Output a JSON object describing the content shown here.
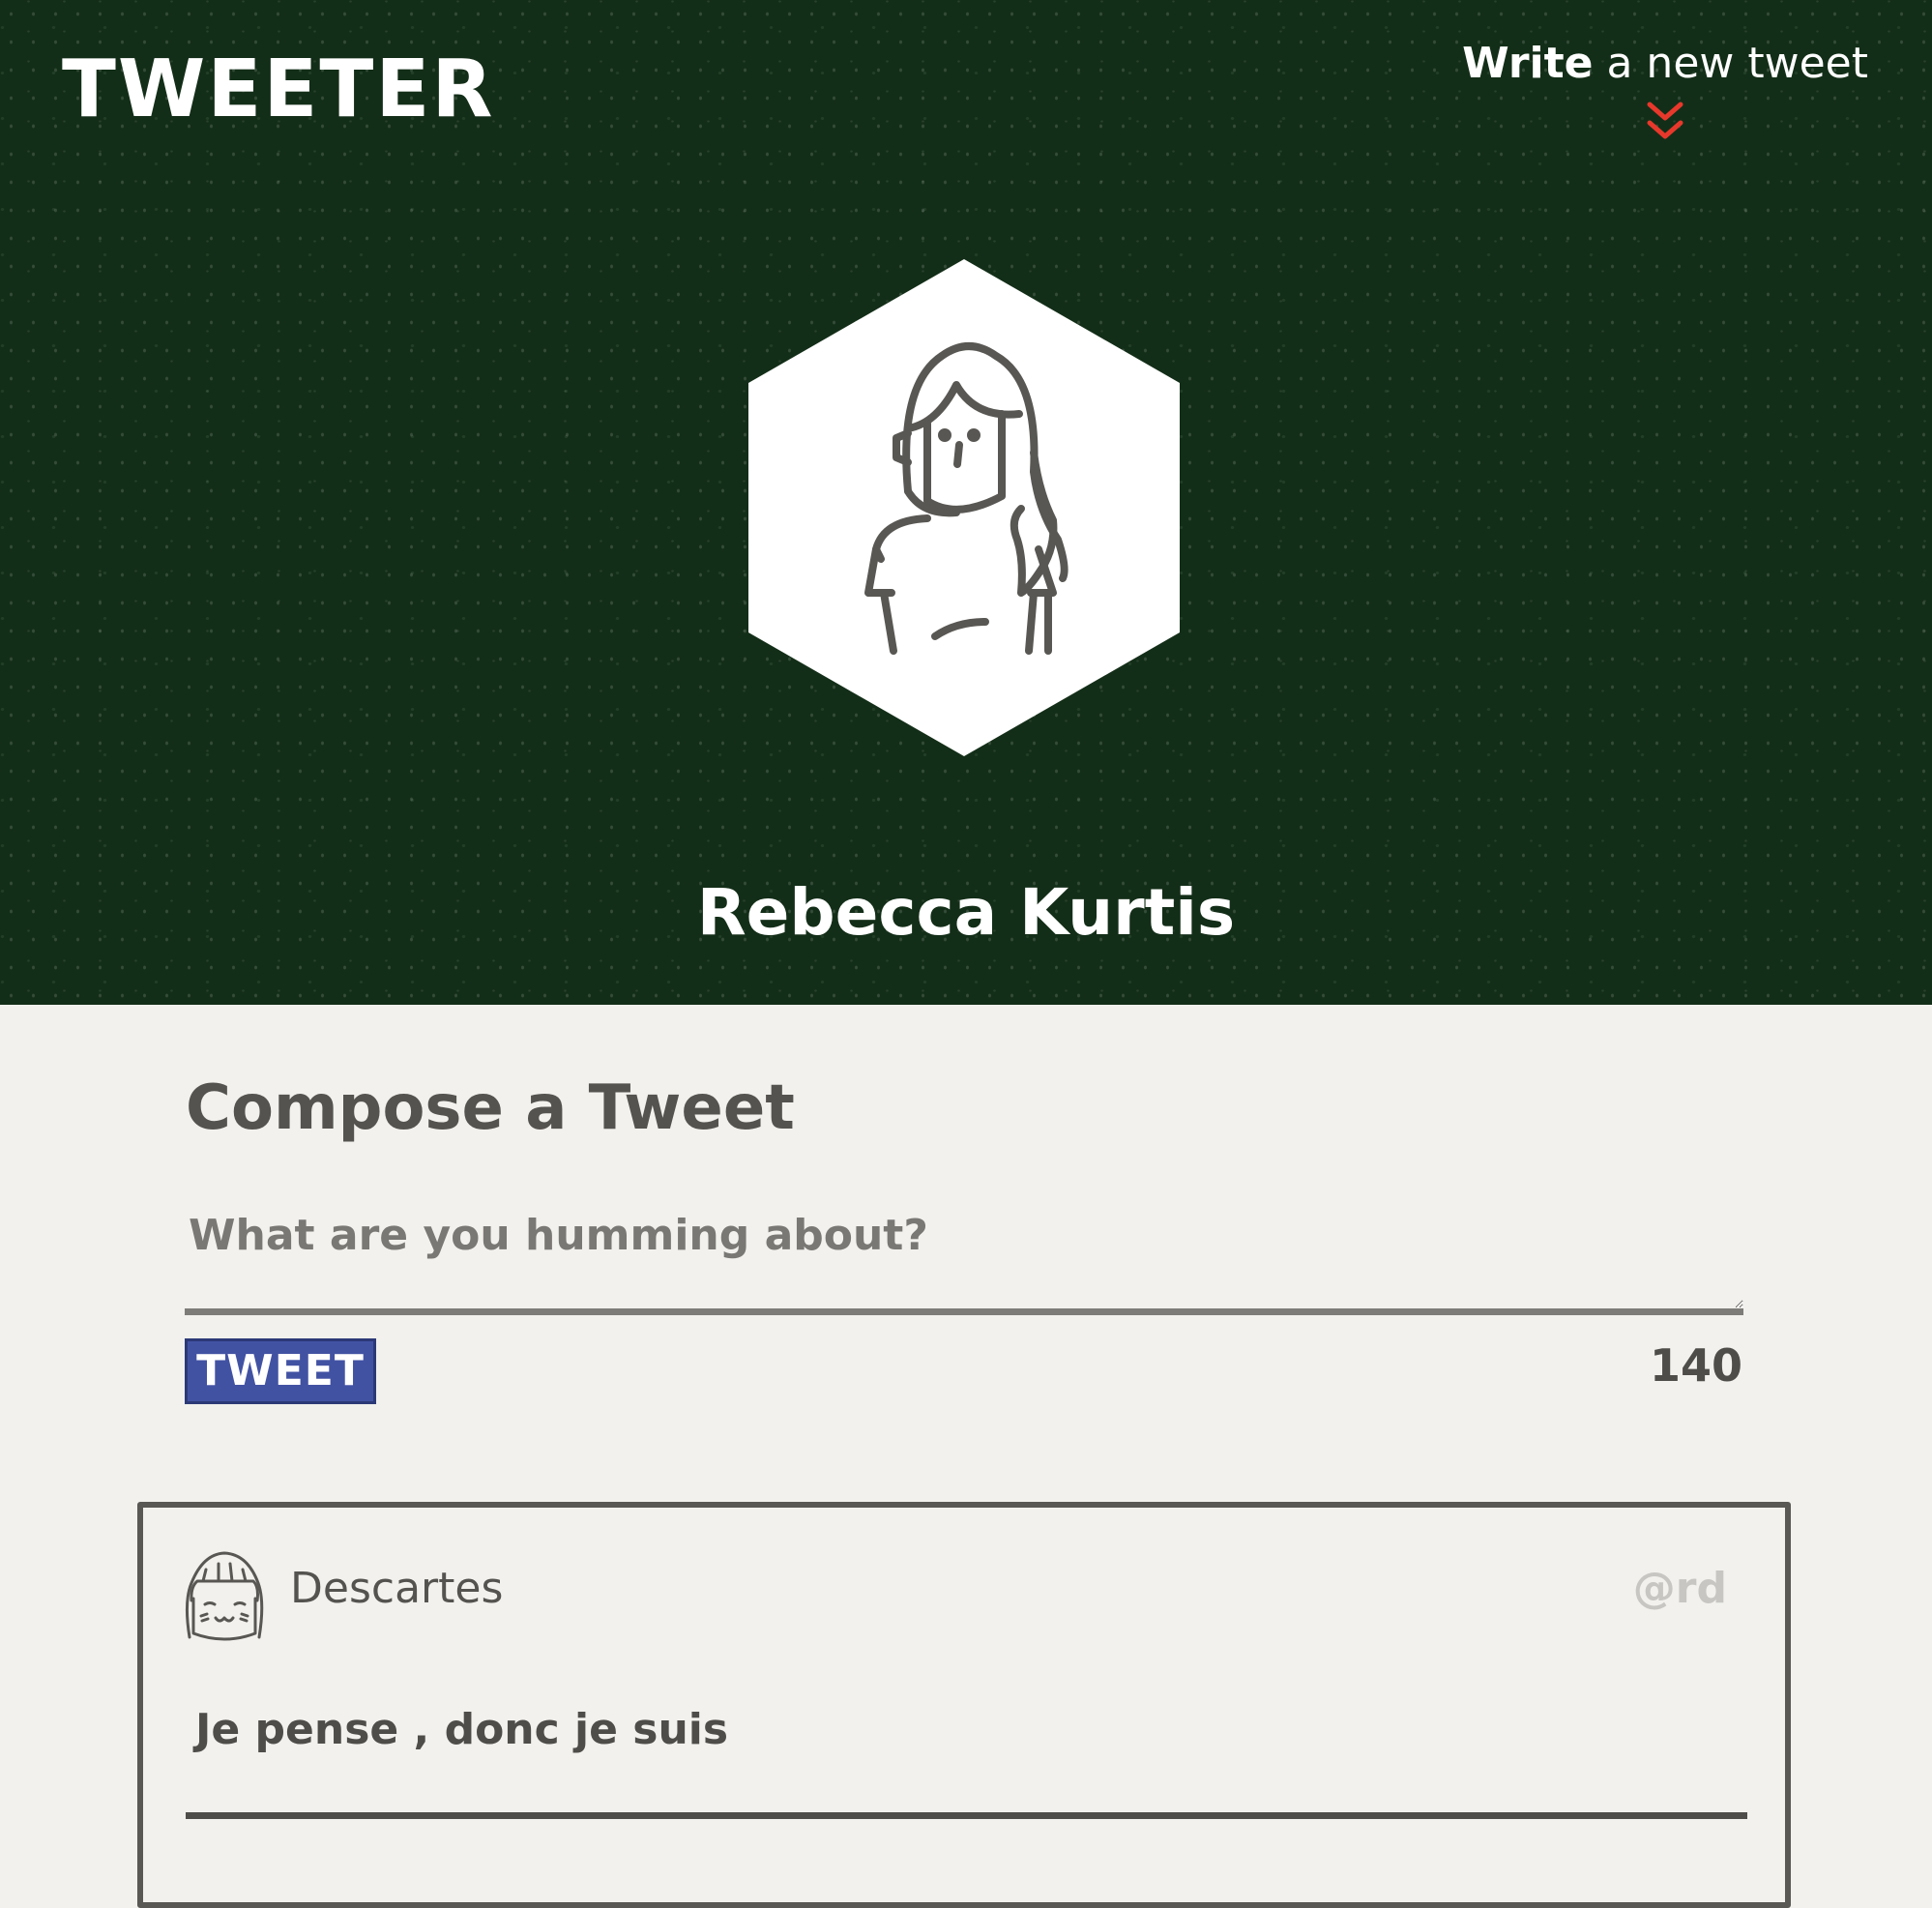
{
  "app": {
    "logo": "TWEETER",
    "compose_toggle": {
      "bold": "Write",
      "rest": " a new tweet",
      "icon": "double-chevron-down-icon",
      "icon_color": "#e8382c"
    },
    "background_color": "#132e18"
  },
  "profile": {
    "name": "Rebecca Kurtis",
    "avatar_icon": "woman-avatar-icon"
  },
  "compose": {
    "title": "Compose a Tweet",
    "placeholder": "What are you humming about?",
    "button_label": "TWEET",
    "button_color": "#4252a3",
    "counter": "140"
  },
  "tweets": [
    {
      "user_name": "Descartes",
      "handle": "@rd",
      "avatar_icon": "smiling-face-avatar-icon",
      "content": "Je pense , donc je suis"
    }
  ]
}
